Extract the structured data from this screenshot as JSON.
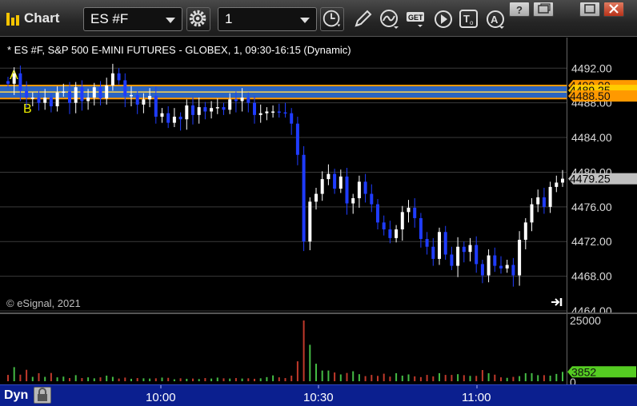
{
  "window": {
    "title": "Chart",
    "symbol_value": "ES #F",
    "interval_value": "1",
    "colors": {
      "toolbar": "#262626",
      "bottom_bar": "#0b1f8f",
      "up_bar": "#ffffff",
      "down_bar": "#1f3cff",
      "level_band": "#2f6fd6",
      "level_line": "#ff9900"
    }
  },
  "toolbar": {
    "icons": [
      "settings-icon",
      "time-template-icon",
      "draw-pen-icon",
      "study-icon",
      "get-data-icon",
      "play-icon",
      "text-tool-icon",
      "alert-icon"
    ]
  },
  "window_controls": [
    "help-icon",
    "restore-icon",
    "maximize-icon",
    "close-icon"
  ],
  "chart": {
    "info_line": "* ES #F, S&P 500 E-MINI FUTURES - GLOBEX, 1, 09:30-16:15 (Dynamic)",
    "watermark": "© eSignal, 2021",
    "level_labels": {
      "a": "A",
      "b": "B"
    },
    "price_ticks": [
      "4492.00",
      "4488.00",
      "4484.00",
      "4480.00",
      "4476.00",
      "4472.00",
      "4468.00",
      "4464.00"
    ],
    "price_flags": [
      {
        "text": "4490.00",
        "value": 4490.0,
        "color": "#ff9900"
      },
      {
        "text": "4489.25",
        "value": 4489.25,
        "color": "#ffcc00"
      },
      {
        "text": "4488.50",
        "value": 4488.5,
        "color": "#ff9900"
      },
      {
        "text": "4479.25",
        "value": 4479.25,
        "color": "#c0c0c0"
      }
    ],
    "volume_ticks": [
      "25000",
      "0"
    ],
    "volume_flag": "3852",
    "time_labels": [
      "10:00",
      "10:30",
      "11:00"
    ],
    "bottom_label": "Dyn"
  },
  "chart_data": {
    "type": "candlestick",
    "ylim": [
      4464,
      4493.5
    ],
    "volume_ylim": [
      0,
      25000
    ],
    "levels": [
      4490.0,
      4489.25,
      4488.5
    ],
    "closes": [
      4490.2,
      4491.4,
      4489.4,
      4488.6,
      4488.6,
      4488.0,
      4488.6,
      4487.6,
      4489.2,
      4489.3,
      4488.0,
      4489.8,
      4488.2,
      4488.6,
      4489.8,
      4488.5,
      4490.0,
      4491.4,
      4490.6,
      4488.8,
      4488.9,
      4487.8,
      4488.4,
      4488.8,
      4486.4,
      4486.8,
      4485.7,
      4486.4,
      4486.1,
      4487.7,
      4486.6,
      4487.5,
      4487.0,
      4487.4,
      4487.5,
      4487.2,
      4488.4,
      4488.2,
      4488.6,
      4488.0,
      4486.6,
      4486.8,
      4487.0,
      4487.0,
      4486.9,
      4486.8,
      4485.6,
      4482.0,
      4472.0,
      4476.6,
      4477.5,
      4479.2,
      4479.8,
      4478.1,
      4479.5,
      4476.4,
      4477.0,
      4478.9,
      4477.5,
      4476.3,
      4474.2,
      4473.4,
      4472.4,
      4473.4,
      4475.4,
      4475.9,
      4474.7,
      4472.3,
      4471.4,
      4470.0,
      4473.1,
      4470.5,
      4469.2,
      4471.4,
      4470.8,
      4471.6,
      4469.4,
      4468.1,
      4470.4,
      4469.2,
      4468.9,
      4469.3,
      4468.1,
      4472.2,
      4474.2,
      4476.3,
      4477.1,
      4476.0,
      4478.3,
      4478.8,
      4479.25
    ],
    "volumes": [
      2600,
      5800,
      2700,
      4700,
      1800,
      3300,
      1800,
      3400,
      1600,
      1900,
      1300,
      2500,
      1300,
      1600,
      1200,
      1600,
      2300,
      1800,
      1100,
      1500,
      1000,
      1300,
      1200,
      1100,
      1200,
      1500,
      1400,
      800,
      1200,
      1000,
      1100,
      900,
      1300,
      1100,
      1500,
      1200,
      1100,
      1300,
      1100,
      1200,
      1000,
      1200,
      1700,
      2400,
      1600,
      1300,
      2300,
      8200,
      25000,
      15000,
      7200,
      4400,
      4400,
      3600,
      2800,
      3400,
      4100,
      2900,
      2100,
      2600,
      2200,
      3100,
      1900,
      3300,
      2300,
      2800,
      2000,
      1700,
      2600,
      2000,
      3300,
      2600,
      2600,
      2900,
      2500,
      2200,
      2200,
      4600,
      3300,
      2700,
      1600,
      1400,
      1800,
      2100,
      3300,
      3300,
      2500,
      2500,
      2300,
      3000,
      3852
    ]
  }
}
